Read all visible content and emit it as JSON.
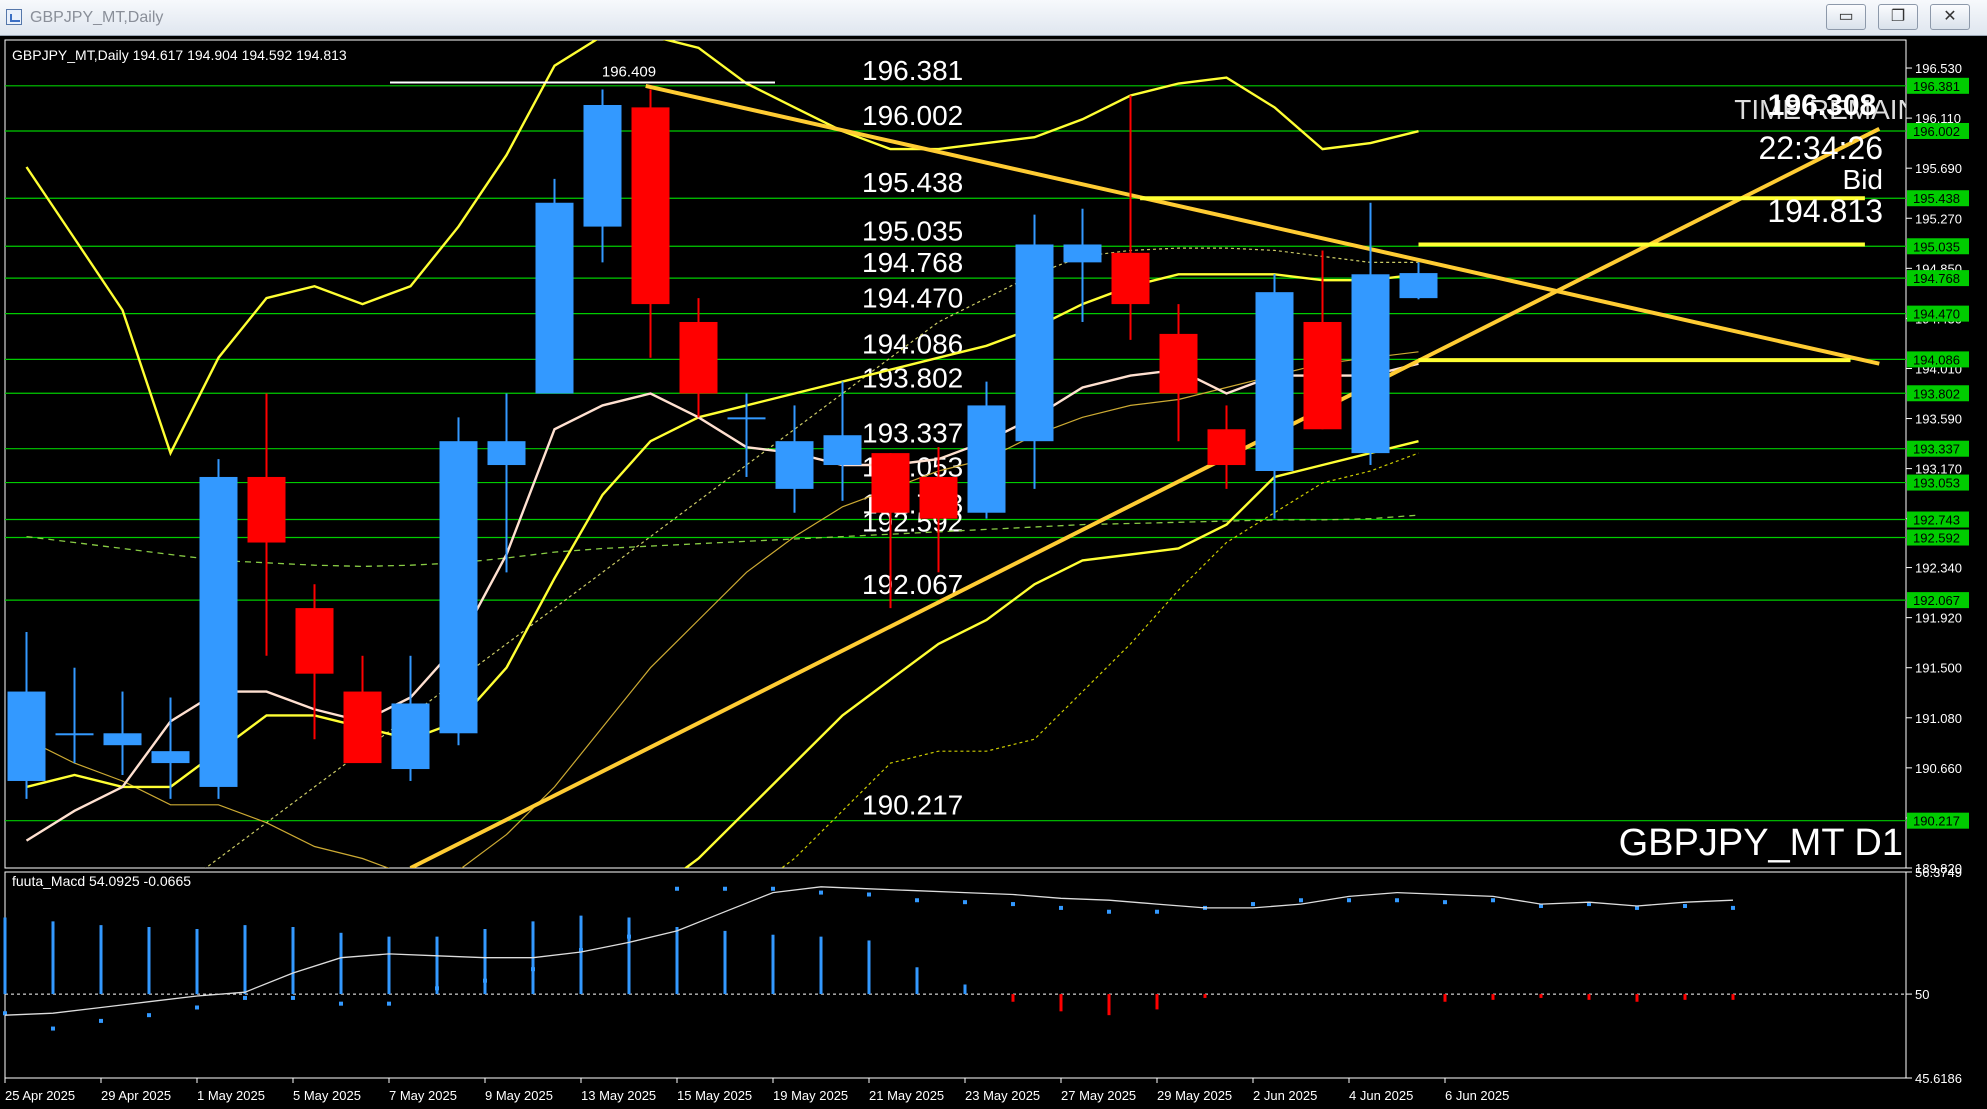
{
  "window": {
    "title": "GBPJPY_MT,Daily",
    "minimize_icon": "minimize-icon",
    "restore_icon": "restore-icon",
    "close_icon": "close-icon",
    "minimize_glyph": "▭",
    "restore_glyph": "❐",
    "close_glyph": "✕"
  },
  "colors": {
    "background": "#000000",
    "bull": "#3399ff",
    "bear": "#ff0000",
    "level": "#00cc00",
    "trend": "#ffcc33",
    "band": "#ffff33",
    "ma_fast": "#ffe0d0",
    "text": "#ffffff"
  },
  "chart_data": [
    {
      "type": "candlestick",
      "header": "GBPJPY_MT,Daily  194.617 194.904 194.592 194.813",
      "symbol_label": "GBPJPY_MT D1",
      "x_labels": [
        "25 Apr 2025",
        "29 Apr 2025",
        "1 May 2025",
        "5 May 2025",
        "7 May 2025",
        "9 May 2025",
        "13 May 2025",
        "15 May 2025",
        "19 May 2025",
        "21 May 2025",
        "23 May 2025",
        "27 May 2025",
        "29 May 2025",
        "2 Jun 2025",
        "4 Jun 2025",
        "6 Jun 2025"
      ],
      "y_ticks": [
        196.53,
        196.11,
        195.69,
        195.27,
        194.85,
        194.43,
        194.01,
        193.59,
        193.17,
        192.75,
        192.34,
        191.92,
        191.5,
        191.08,
        190.66,
        190.24,
        189.82
      ],
      "y_tick_labels": [
        "196.530",
        "196.110",
        "195.690",
        "195.270",
        "194.850",
        "194.430",
        "194.010",
        "193.590",
        "193.170",
        "192.750",
        "192.340",
        "191.920",
        "191.500",
        "191.080",
        "190.660",
        "190.240",
        "189.820"
      ],
      "ylim": [
        189.82,
        196.74
      ],
      "candles": [
        {
          "o": 190.55,
          "h": 191.8,
          "l": 190.4,
          "c": 191.3
        },
        {
          "o": 190.95,
          "h": 191.5,
          "l": 190.7,
          "c": 190.95
        },
        {
          "o": 190.85,
          "h": 191.3,
          "l": 190.6,
          "c": 190.95
        },
        {
          "o": 190.7,
          "h": 191.25,
          "l": 190.4,
          "c": 190.8
        },
        {
          "o": 190.5,
          "h": 193.25,
          "l": 190.4,
          "c": 193.1
        },
        {
          "o": 193.1,
          "h": 193.8,
          "l": 191.6,
          "c": 192.55
        },
        {
          "o": 192.0,
          "h": 192.2,
          "l": 190.9,
          "c": 191.45
        },
        {
          "o": 191.3,
          "h": 191.6,
          "l": 190.75,
          "c": 190.7
        },
        {
          "o": 190.65,
          "h": 191.6,
          "l": 190.55,
          "c": 191.2
        },
        {
          "o": 190.95,
          "h": 193.6,
          "l": 190.85,
          "c": 193.4
        },
        {
          "o": 193.2,
          "h": 193.8,
          "l": 192.3,
          "c": 193.4
        },
        {
          "o": 193.8,
          "h": 195.6,
          "l": 193.8,
          "c": 195.4
        },
        {
          "o": 195.2,
          "h": 196.35,
          "l": 194.9,
          "c": 196.22
        },
        {
          "o": 196.2,
          "h": 196.35,
          "l": 194.1,
          "c": 194.55
        },
        {
          "o": 194.4,
          "h": 194.6,
          "l": 193.6,
          "c": 193.8
        },
        {
          "o": 193.6,
          "h": 193.8,
          "l": 193.1,
          "c": 193.6
        },
        {
          "o": 193.0,
          "h": 193.7,
          "l": 192.8,
          "c": 193.4
        },
        {
          "o": 193.2,
          "h": 193.9,
          "l": 192.9,
          "c": 193.45
        },
        {
          "o": 193.3,
          "h": 193.3,
          "l": 192.0,
          "c": 192.8
        },
        {
          "o": 193.1,
          "h": 193.35,
          "l": 192.3,
          "c": 192.75
        },
        {
          "o": 192.8,
          "h": 193.9,
          "l": 192.75,
          "c": 193.7
        },
        {
          "o": 193.4,
          "h": 195.3,
          "l": 193.0,
          "c": 195.05
        },
        {
          "o": 194.9,
          "h": 195.35,
          "l": 194.4,
          "c": 195.05
        },
        {
          "o": 194.98,
          "h": 196.3,
          "l": 194.25,
          "c": 194.55
        },
        {
          "o": 194.3,
          "h": 194.55,
          "l": 193.4,
          "c": 193.8
        },
        {
          "o": 193.5,
          "h": 193.7,
          "l": 193.0,
          "c": 193.2
        },
        {
          "o": 193.15,
          "h": 194.8,
          "l": 192.75,
          "c": 194.65
        },
        {
          "o": 194.4,
          "h": 195.0,
          "l": 193.5,
          "c": 193.5
        },
        {
          "o": 193.3,
          "h": 195.4,
          "l": 193.2,
          "c": 194.8
        },
        {
          "o": 194.6,
          "h": 194.9,
          "l": 194.59,
          "c": 194.81
        }
      ],
      "levels": [
        {
          "value": 196.381,
          "label": "196.381"
        },
        {
          "value": 196.002,
          "label": "196.002"
        },
        {
          "value": 195.438,
          "label": "195.438"
        },
        {
          "value": 195.035,
          "label": "195.035"
        },
        {
          "value": 194.768,
          "label": "194.768"
        },
        {
          "value": 194.47,
          "label": "194.470"
        },
        {
          "value": 194.086,
          "label": "194.086"
        },
        {
          "value": 193.802,
          "label": "193.802"
        },
        {
          "value": 193.337,
          "label": "193.337"
        },
        {
          "value": 193.053,
          "label": "193.053"
        },
        {
          "value": 192.743,
          "label": "192.743"
        },
        {
          "value": 192.592,
          "label": "192.592"
        },
        {
          "value": 192.067,
          "label": "192.067"
        },
        {
          "value": 190.217,
          "label": "190.217"
        }
      ],
      "high_marker": {
        "value": 196.409,
        "label": "196.409",
        "bar": 12
      },
      "info": {
        "price_big": "196.308",
        "time_remain_label": "TIME REMAIN",
        "countdown": "22:34:26",
        "bid_label": "Bid",
        "bid": "194.813"
      },
      "trendlines": [
        {
          "from": {
            "bar": 8,
            "v": 189.82
          },
          "to": {
            "bar": 38.6,
            "v": 196.02
          }
        },
        {
          "from": {
            "bar": 12.9,
            "v": 196.38
          },
          "to": {
            "bar": 38.6,
            "v": 194.05
          }
        }
      ],
      "hlines": [
        {
          "v": 195.438,
          "from": 23.2,
          "to": 38.3
        },
        {
          "v": 195.05,
          "from": 29.0,
          "to": 38.3
        },
        {
          "v": 194.08,
          "from": 29.0,
          "to": 38.0
        }
      ],
      "series": {
        "ma_fast": [
          190.05,
          190.3,
          190.5,
          191.05,
          191.3,
          191.3,
          191.15,
          191.05,
          191.25,
          191.7,
          192.45,
          193.5,
          193.7,
          193.8,
          193.6,
          193.35,
          193.3,
          193.2,
          193.2,
          193.25,
          193.4,
          193.6,
          193.85,
          193.95,
          194.0,
          193.8,
          193.95,
          193.95,
          193.95,
          194.05
        ],
        "ma_slow": [
          190.5,
          190.6,
          190.5,
          190.5,
          190.8,
          191.1,
          191.1,
          191.0,
          190.9,
          191.05,
          191.5,
          192.25,
          192.95,
          193.4,
          193.6,
          193.7,
          193.8,
          193.9,
          194.0,
          194.1,
          194.2,
          194.35,
          194.55,
          194.7,
          194.8,
          194.8,
          194.8,
          194.75,
          194.75,
          194.8
        ],
        "band_upper_outer": [
          195.7,
          195.1,
          194.5,
          193.3,
          194.1,
          194.6,
          194.7,
          194.55,
          194.7,
          195.2,
          195.8,
          196.55,
          196.8,
          196.8,
          196.7,
          196.4,
          196.2,
          196.0,
          195.85,
          195.85,
          195.9,
          195.95,
          196.1,
          196.3,
          196.4,
          196.45,
          196.2,
          195.85,
          195.9,
          196.0
        ],
        "band_upper_inner": [
          195.2,
          194.8,
          194.3,
          193.25,
          193.9,
          194.4,
          194.6,
          194.55,
          194.65,
          194.95,
          195.5,
          196.0,
          196.3,
          196.4,
          196.35,
          196.22,
          196.25,
          196.22,
          196.05,
          196.03,
          196.05,
          196.1,
          196.25,
          196.4,
          196.55,
          196.6,
          196.4,
          196.1,
          195.95,
          196.0
        ],
        "band_mid": [
          190.9,
          190.7,
          190.55,
          190.35,
          190.35,
          190.2,
          190.0,
          189.9,
          189.75,
          189.8,
          190.1,
          190.5,
          191.0,
          191.5,
          191.9,
          192.3,
          192.6,
          192.85,
          193.0,
          193.15,
          193.25,
          193.45,
          193.6,
          193.7,
          193.75,
          193.85,
          193.95,
          194.05,
          194.1,
          194.15
        ],
        "band_lower_inner": [
          189.8,
          189.6,
          189.5,
          189.3,
          189.1,
          188.9,
          188.7,
          188.5,
          188.3,
          188.3,
          188.5,
          188.8,
          189.2,
          189.6,
          189.9,
          190.3,
          190.7,
          191.1,
          191.4,
          191.7,
          191.9,
          192.2,
          192.4,
          192.45,
          192.5,
          192.7,
          193.1,
          193.2,
          193.3,
          193.4
        ],
        "band_lower_outer": [
          189.4,
          189.2,
          189.0,
          188.8,
          188.6,
          188.4,
          188.2,
          188.0,
          187.8,
          187.8,
          188.0,
          188.3,
          188.6,
          188.9,
          189.2,
          189.6,
          189.9,
          190.3,
          190.7,
          190.8,
          190.8,
          190.9,
          191.3,
          191.7,
          192.15,
          192.55,
          192.8,
          193.05,
          193.15,
          193.3
        ],
        "ma_long": [
          192.6,
          192.55,
          192.5,
          192.45,
          192.4,
          192.38,
          192.36,
          192.35,
          192.36,
          192.38,
          192.42,
          192.47,
          192.5,
          192.52,
          192.54,
          192.56,
          192.58,
          192.6,
          192.62,
          192.64,
          192.66,
          192.68,
          192.7,
          192.71,
          192.72,
          192.73,
          192.74,
          192.74,
          192.75,
          192.78
        ],
        "env_upper": [
          189.0,
          189.1,
          189.3,
          189.6,
          189.9,
          190.2,
          190.5,
          190.8,
          191.1,
          191.4,
          191.7,
          192.0,
          192.3,
          192.6,
          192.9,
          193.2,
          193.5,
          193.8,
          194.1,
          194.4,
          194.6,
          194.8,
          194.95,
          195.0,
          195.02,
          195.02,
          195.0,
          194.95,
          194.9,
          194.9
        ]
      }
    },
    {
      "type": "indicator",
      "name": "fuuta_Macd",
      "header": "fuuta_Macd 54.0925  -0.0665",
      "y_tick_labels": [
        "56.3749",
        "50",
        "45.6186"
      ],
      "ylim": [
        45.6186,
        56.3749
      ],
      "zero": 50,
      "hist": [
        4.0,
        3.8,
        3.6,
        3.5,
        3.4,
        3.6,
        3.5,
        3.2,
        3.0,
        3.0,
        3.4,
        3.8,
        4.1,
        4.0,
        3.5,
        3.3,
        3.1,
        3.0,
        2.8,
        1.4,
        0.5,
        -0.4,
        -0.9,
        -1.1,
        -0.8,
        -0.2,
        0.0,
        0.0,
        0.0,
        0.0,
        -0.4,
        -0.3,
        -0.2,
        -0.3,
        -0.4,
        -0.3,
        -0.3
      ],
      "signal": [
        49.0,
        48.2,
        48.6,
        48.9,
        49.3,
        49.8,
        49.8,
        49.5,
        49.5,
        50.3,
        50.7,
        51.3,
        52.3,
        53.0,
        55.5,
        55.5,
        55.5,
        55.3,
        55.2,
        54.9,
        54.8,
        54.7,
        54.5,
        54.3,
        54.3,
        54.5,
        54.7,
        54.9,
        54.9,
        54.9,
        54.8,
        54.9,
        54.6,
        54.7,
        54.5,
        54.6,
        54.5
      ],
      "line": [
        48.9,
        49.0,
        49.3,
        49.6,
        49.9,
        50.1,
        51.1,
        51.9,
        52.1,
        52.0,
        51.9,
        51.9,
        52.2,
        52.7,
        53.3,
        54.3,
        55.3,
        55.6,
        55.5,
        55.4,
        55.3,
        55.2,
        55.0,
        54.9,
        54.7,
        54.5,
        54.5,
        54.7,
        55.1,
        55.3,
        55.2,
        55.1,
        54.7,
        54.8,
        54.6,
        54.8,
        54.9
      ]
    }
  ]
}
